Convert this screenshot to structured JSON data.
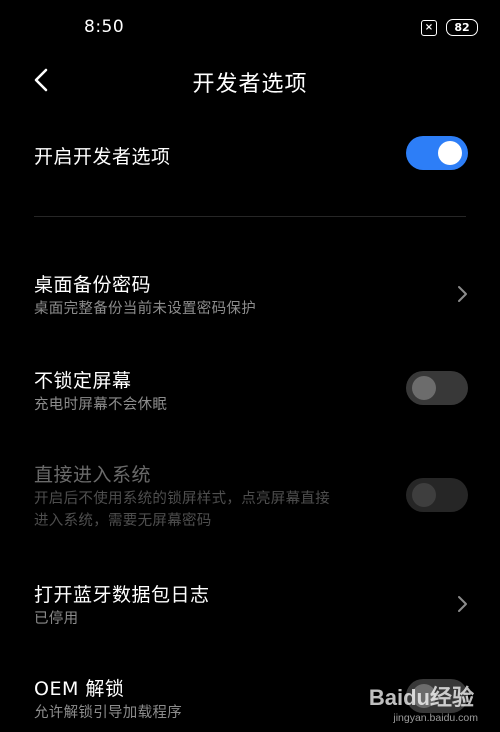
{
  "status_bar": {
    "time": "8:50",
    "sim_icon": "sim-x-icon",
    "sim_glyph": "×",
    "battery": "82"
  },
  "header": {
    "back_icon": "chevron-left-icon",
    "title": "开发者选项"
  },
  "colors": {
    "background": "#000000",
    "toggle_on": "#2d7ef7",
    "toggle_off": "#383838",
    "secondary_text": "#8c8c8c",
    "disabled_text": "#6a6a6a"
  },
  "settings": {
    "developer_options": {
      "label": "开启开发者选项",
      "toggle_state": "on"
    },
    "desktop_backup_password": {
      "label": "桌面备份密码",
      "subtitle": "桌面完整备份当前未设置密码保护",
      "control": "chevron-right-icon"
    },
    "stay_awake": {
      "label": "不锁定屏幕",
      "subtitle": "充电时屏幕不会休眠",
      "toggle_state": "off"
    },
    "direct_boot": {
      "label": "直接进入系统",
      "subtitle_line1": "开启后不使用系统的锁屏样式，点亮屏幕直接",
      "subtitle_line2": "进入系统，需要无屏幕密码",
      "toggle_state": "off",
      "disabled": true
    },
    "bluetooth_hci_log": {
      "label": "打开蓝牙数据包日志",
      "subtitle": "已停用",
      "control": "chevron-right-icon"
    },
    "oem_unlock": {
      "label": "OEM 解锁",
      "subtitle": "允许解锁引导加载程序",
      "toggle_state": "off"
    }
  },
  "watermark": {
    "logo": "Baidu经验",
    "url": "jingyan.baidu.com"
  }
}
